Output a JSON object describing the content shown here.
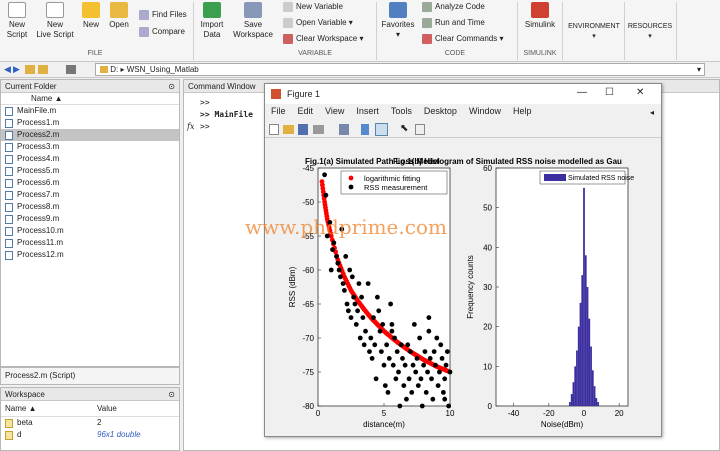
{
  "ribbon": {
    "new_script": "New\nScript",
    "new_live_script": "New\nLive Script",
    "new": "New",
    "open": "Open",
    "find_files": "Find Files",
    "compare": "Compare",
    "import_data": "Import\nData",
    "save_workspace": "Save\nWorkspace",
    "new_variable": "New Variable",
    "open_variable": "Open Variable",
    "clear_workspace": "Clear Workspace",
    "favorites": "Favorites",
    "analyze_code": "Analyze Code",
    "run_and_time": "Run and Time",
    "clear_commands": "Clear Commands",
    "simulink": "Simulink",
    "environment": "ENVIRONMENT",
    "resources": "RESOURCES",
    "groups": {
      "file": "FILE",
      "variable": "VARIABLE",
      "code": "CODE",
      "simulink": "SIMULINK"
    }
  },
  "address": {
    "drive": "D:",
    "sep": "▸",
    "folder": "WSN_Using_Matlab"
  },
  "current_folder": {
    "title": "Current Folder",
    "col_name": "Name ▲",
    "files": [
      "MainFile.m",
      "Process1.m",
      "Process2.m",
      "Process3.m",
      "Process4.m",
      "Process5.m",
      "Process6.m",
      "Process7.m",
      "Process8.m",
      "Process9.m",
      "Process10.m",
      "Process11.m",
      "Process12.m"
    ],
    "selected_index": 2,
    "details": "Process2.m  (Script)"
  },
  "workspace": {
    "title": "Workspace",
    "col_name": "Name ▲",
    "col_value": "Value",
    "vars": [
      {
        "name": "beta",
        "value": "2"
      },
      {
        "name": "d",
        "value": "96x1 double"
      }
    ]
  },
  "command_window": {
    "title": "Command Window",
    "lines": [
      ">>",
      ">> MainFile",
      ">>"
    ],
    "fx": "fx"
  },
  "figure": {
    "title": "Figure 1",
    "menu": [
      "File",
      "Edit",
      "View",
      "Insert",
      "Tools",
      "Desktop",
      "Window",
      "Help"
    ],
    "title_left": "Fig.1(a) Simulated Path Loss Model",
    "title_right": "Fig.1(b) Histogram of Simulated RSS noise modelled as Gau",
    "win_min": "—",
    "win_max": "☐",
    "win_close": "✕"
  },
  "chart_data": [
    {
      "type": "scatter",
      "title": "Fig.1(a) Simulated Path Loss Model",
      "xlabel": "distance(m)",
      "ylabel": "RSS (dBm)",
      "xlim": [
        0,
        10
      ],
      "ylim": [
        -80,
        -45
      ],
      "xticks": [
        0,
        5,
        10
      ],
      "yticks": [
        -45,
        -50,
        -55,
        -60,
        -65,
        -70,
        -75,
        -80
      ],
      "legend_position": "top-right",
      "series": [
        {
          "name": "logarithmic fitting",
          "color": "#ff0000",
          "kind": "curve",
          "x": [
            0.3,
            0.5,
            0.7,
            1,
            1.5,
            2,
            2.5,
            3,
            3.5,
            4,
            4.5,
            5,
            5.5,
            6,
            6.5,
            7,
            7.5,
            8,
            8.5,
            9,
            9.5,
            10
          ],
          "y": [
            -47,
            -50,
            -52.5,
            -55,
            -58.5,
            -61,
            -63,
            -64.5,
            -65.8,
            -67,
            -68,
            -69,
            -69.8,
            -70.6,
            -71.3,
            -72,
            -72.6,
            -73.2,
            -73.7,
            -74.2,
            -74.6,
            -75
          ]
        },
        {
          "name": "RSS measurement",
          "color": "#000000",
          "kind": "points",
          "x": [
            0.5,
            0.6,
            0.7,
            0.9,
            1.0,
            1.1,
            1.2,
            1.4,
            1.5,
            1.6,
            1.7,
            1.8,
            1.9,
            2.0,
            2.1,
            2.2,
            2.3,
            2.4,
            2.5,
            2.6,
            2.7,
            2.8,
            2.9,
            3.0,
            3.1,
            3.2,
            3.3,
            3.4,
            3.5,
            3.6,
            3.8,
            3.9,
            4.0,
            4.1,
            4.2,
            4.3,
            4.4,
            4.5,
            4.6,
            4.7,
            4.8,
            4.9,
            5.0,
            5.1,
            5.2,
            5.3,
            5.4,
            5.5,
            5.6,
            5.7,
            5.8,
            5.9,
            6.0,
            6.1,
            6.2,
            6.3,
            6.4,
            6.5,
            6.6,
            6.7,
            6.8,
            6.9,
            7.0,
            7.1,
            7.2,
            7.3,
            7.4,
            7.5,
            7.6,
            7.7,
            7.8,
            7.9,
            8.0,
            8.1,
            8.2,
            8.3,
            8.4,
            8.5,
            8.6,
            8.7,
            8.8,
            8.9,
            9.0,
            9.1,
            9.2,
            9.3,
            9.4,
            9.5,
            9.6,
            9.7,
            9.8,
            9.9,
            10.0,
            9.6,
            8.4,
            5.6
          ],
          "y": [
            -46,
            -49,
            -55,
            -53,
            -60,
            -57,
            -56,
            -58,
            -59,
            -60,
            -61,
            -54,
            -62,
            -63,
            -58,
            -65,
            -66,
            -60,
            -67,
            -61,
            -64,
            -65,
            -68,
            -66,
            -62,
            -70,
            -64,
            -67,
            -71,
            -69,
            -62,
            -72,
            -70,
            -73,
            -67,
            -71,
            -76,
            -64,
            -66,
            -69,
            -72,
            -68,
            -74,
            -77,
            -71,
            -78,
            -73,
            -65,
            -68,
            -74,
            -70,
            -76,
            -72,
            -75,
            -80,
            -71,
            -73,
            -77,
            -74,
            -79,
            -71,
            -76,
            -72,
            -78,
            -74,
            -68,
            -75,
            -73,
            -77,
            -70,
            -76,
            -80,
            -74,
            -72,
            -78,
            -75,
            -69,
            -73,
            -76,
            -79,
            -72,
            -74,
            -70,
            -77,
            -75,
            -71,
            -73,
            -78,
            -76,
            -74,
            -72,
            -80,
            -75,
            -79,
            -67,
            -69
          ]
        }
      ]
    },
    {
      "type": "bar",
      "title": "Fig.1(b) Histogram of Simulated RSS noise modelled as Gau",
      "xlabel": "Noise(dBm)",
      "ylabel": "Frequency counts",
      "xlim": [
        -50,
        25
      ],
      "ylim": [
        0,
        60
      ],
      "xticks": [
        -40,
        -20,
        0,
        20
      ],
      "yticks": [
        0,
        10,
        20,
        30,
        40,
        50,
        60
      ],
      "legend_position": "top-right",
      "series": [
        {
          "name": "Simulated RSS noise",
          "color": "#3b2e9e",
          "x": [
            -8,
            -7,
            -6,
            -5,
            -4,
            -3,
            -2,
            -1,
            0,
            1,
            2,
            3,
            4,
            5,
            6,
            7,
            8
          ],
          "values": [
            1,
            3,
            6,
            10,
            14,
            20,
            26,
            33,
            55,
            38,
            30,
            22,
            15,
            9,
            5,
            2,
            1
          ]
        }
      ]
    }
  ],
  "watermark": "www.phdprime.com"
}
